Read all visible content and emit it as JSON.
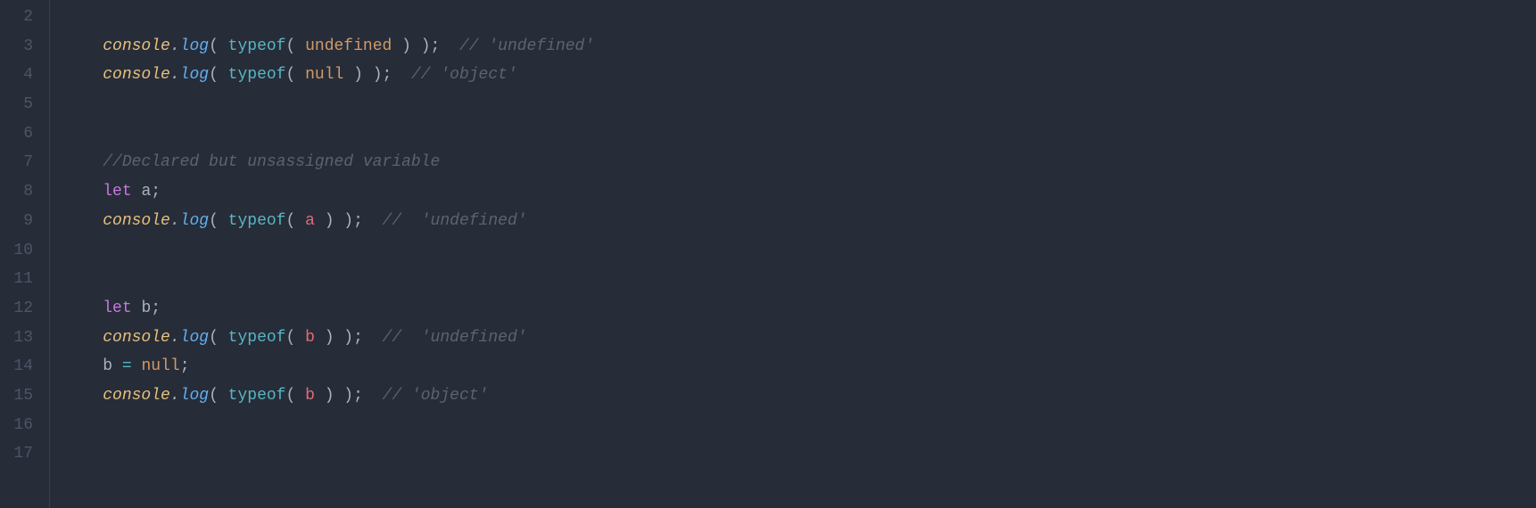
{
  "editor": {
    "first_line_number": 2,
    "indent": "    ",
    "lines": [
      {
        "n": 2,
        "tokens": []
      },
      {
        "n": 3,
        "tokens": [
          {
            "c": "tok-obj",
            "t": "console"
          },
          {
            "c": "tok-dot",
            "t": "."
          },
          {
            "c": "tok-method",
            "t": "log"
          },
          {
            "c": "tok-punc",
            "t": "( "
          },
          {
            "c": "tok-kwop",
            "t": "typeof"
          },
          {
            "c": "tok-punc",
            "t": "( "
          },
          {
            "c": "tok-const",
            "t": "undefined"
          },
          {
            "c": "tok-punc",
            "t": " ) );  "
          },
          {
            "c": "tok-comm",
            "t": "// 'undefined'"
          }
        ]
      },
      {
        "n": 4,
        "tokens": [
          {
            "c": "tok-obj",
            "t": "console"
          },
          {
            "c": "tok-dot",
            "t": "."
          },
          {
            "c": "tok-method",
            "t": "log"
          },
          {
            "c": "tok-punc",
            "t": "( "
          },
          {
            "c": "tok-kwop",
            "t": "typeof"
          },
          {
            "c": "tok-punc",
            "t": "( "
          },
          {
            "c": "tok-const",
            "t": "null"
          },
          {
            "c": "tok-punc",
            "t": " ) );  "
          },
          {
            "c": "tok-comm",
            "t": "// 'object'"
          }
        ]
      },
      {
        "n": 5,
        "tokens": []
      },
      {
        "n": 6,
        "tokens": []
      },
      {
        "n": 7,
        "tokens": [
          {
            "c": "tok-comm",
            "t": "//Declared but unsassigned variable"
          }
        ]
      },
      {
        "n": 8,
        "tokens": [
          {
            "c": "tok-key",
            "t": "let"
          },
          {
            "c": "tok-punc",
            "t": " "
          },
          {
            "c": "tok-ident",
            "t": "a"
          },
          {
            "c": "tok-punc",
            "t": ";"
          }
        ]
      },
      {
        "n": 9,
        "tokens": [
          {
            "c": "tok-obj",
            "t": "console"
          },
          {
            "c": "tok-dot",
            "t": "."
          },
          {
            "c": "tok-method",
            "t": "log"
          },
          {
            "c": "tok-punc",
            "t": "( "
          },
          {
            "c": "tok-kwop",
            "t": "typeof"
          },
          {
            "c": "tok-punc",
            "t": "( "
          },
          {
            "c": "tok-var",
            "t": "a"
          },
          {
            "c": "tok-punc",
            "t": " ) );  "
          },
          {
            "c": "tok-comm",
            "t": "//  'undefined'"
          }
        ]
      },
      {
        "n": 10,
        "tokens": []
      },
      {
        "n": 11,
        "tokens": []
      },
      {
        "n": 12,
        "tokens": [
          {
            "c": "tok-key",
            "t": "let"
          },
          {
            "c": "tok-punc",
            "t": " "
          },
          {
            "c": "tok-ident",
            "t": "b"
          },
          {
            "c": "tok-punc",
            "t": ";"
          }
        ]
      },
      {
        "n": 13,
        "tokens": [
          {
            "c": "tok-obj",
            "t": "console"
          },
          {
            "c": "tok-dot",
            "t": "."
          },
          {
            "c": "tok-method",
            "t": "log"
          },
          {
            "c": "tok-punc",
            "t": "( "
          },
          {
            "c": "tok-kwop",
            "t": "typeof"
          },
          {
            "c": "tok-punc",
            "t": "( "
          },
          {
            "c": "tok-var",
            "t": "b"
          },
          {
            "c": "tok-punc",
            "t": " ) );  "
          },
          {
            "c": "tok-comm",
            "t": "//  'undefined'"
          }
        ]
      },
      {
        "n": 14,
        "tokens": [
          {
            "c": "tok-ident",
            "t": "b"
          },
          {
            "c": "tok-punc",
            "t": " "
          },
          {
            "c": "tok-op",
            "t": "="
          },
          {
            "c": "tok-punc",
            "t": " "
          },
          {
            "c": "tok-const",
            "t": "null"
          },
          {
            "c": "tok-punc",
            "t": ";"
          }
        ]
      },
      {
        "n": 15,
        "tokens": [
          {
            "c": "tok-obj",
            "t": "console"
          },
          {
            "c": "tok-dot",
            "t": "."
          },
          {
            "c": "tok-method",
            "t": "log"
          },
          {
            "c": "tok-punc",
            "t": "( "
          },
          {
            "c": "tok-kwop",
            "t": "typeof"
          },
          {
            "c": "tok-punc",
            "t": "( "
          },
          {
            "c": "tok-var",
            "t": "b"
          },
          {
            "c": "tok-punc",
            "t": " ) );  "
          },
          {
            "c": "tok-comm",
            "t": "// 'object'"
          }
        ]
      },
      {
        "n": 16,
        "tokens": []
      },
      {
        "n": 17,
        "tokens": []
      }
    ]
  }
}
